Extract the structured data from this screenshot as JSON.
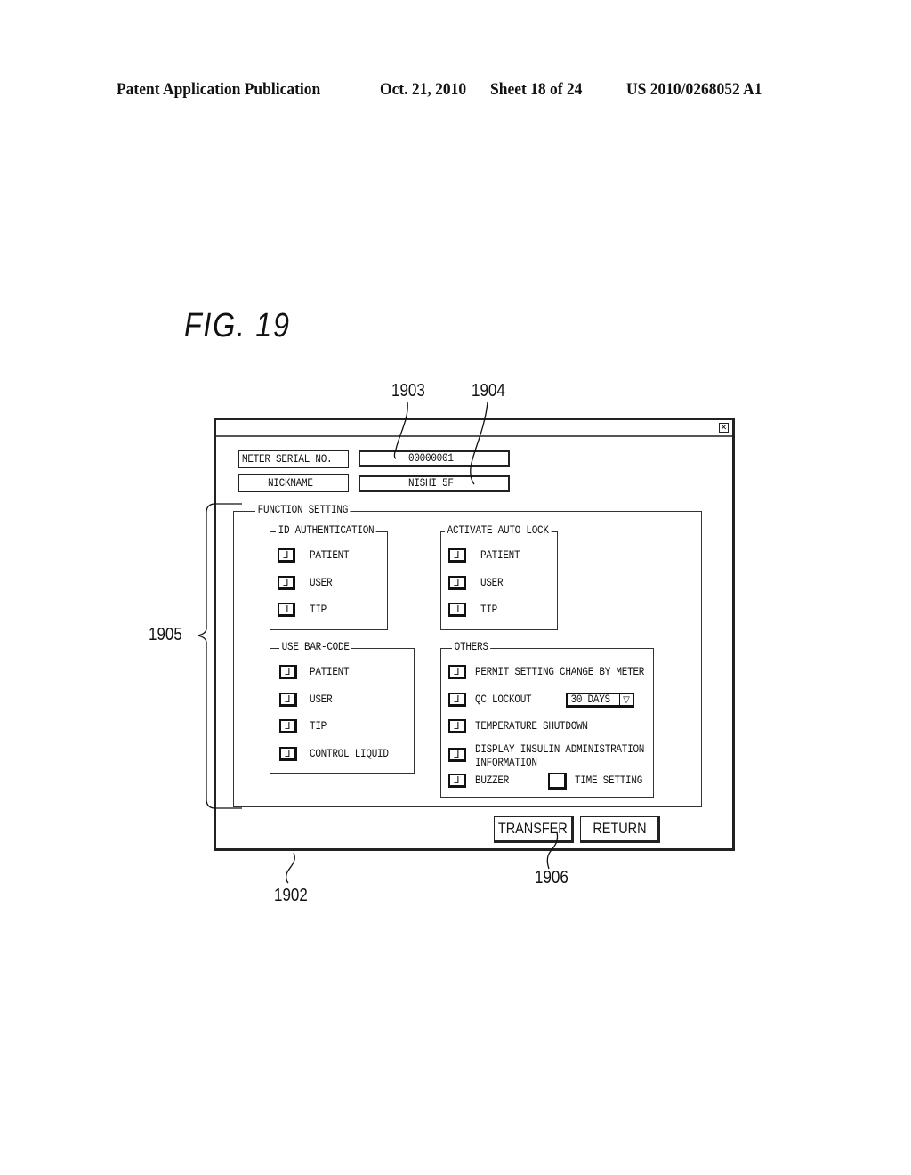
{
  "header": {
    "publication": "Patent Application Publication",
    "date": "Oct. 21, 2010",
    "sheet": "Sheet 18 of 24",
    "number": "US 2010/0268052 A1"
  },
  "figure": {
    "label": "FIG. 19"
  },
  "reference_numerals": {
    "window": "1902",
    "serial_field": "1903",
    "nickname_field": "1904",
    "function_setting": "1905",
    "transfer_button": "1906"
  },
  "dialog": {
    "close_icon": "close-icon",
    "meter_serial_label": "METER SERIAL NO.",
    "meter_serial_value": "00000001",
    "nickname_label": "NICKNAME",
    "nickname_value": "NISHI 5F",
    "function_setting": {
      "title": "FUNCTION SETTING",
      "id_authentication": {
        "title": "ID AUTHENTICATION",
        "items": [
          {
            "label": "PATIENT",
            "checked": true
          },
          {
            "label": "USER",
            "checked": true
          },
          {
            "label": "TIP",
            "checked": true
          }
        ]
      },
      "activate_auto_lock": {
        "title": "ACTIVATE AUTO LOCK",
        "items": [
          {
            "label": "PATIENT",
            "checked": true
          },
          {
            "label": "USER",
            "checked": true
          },
          {
            "label": "TIP",
            "checked": true
          }
        ]
      },
      "use_bar_code": {
        "title": "USE BAR-CODE",
        "items": [
          {
            "label": "PATIENT",
            "checked": true
          },
          {
            "label": "USER",
            "checked": true
          },
          {
            "label": "TIP",
            "checked": true
          },
          {
            "label": "CONTROL LIQUID",
            "checked": true
          }
        ]
      },
      "others": {
        "title": "OTHERS",
        "permit_setting_change": {
          "label": "PERMIT SETTING CHANGE BY METER",
          "checked": true
        },
        "qc_lockout": {
          "label": "QC LOCKOUT",
          "checked": true,
          "select_value": "30 DAYS"
        },
        "temperature_shutdown": {
          "label": "TEMPERATURE SHUTDOWN",
          "checked": true
        },
        "display_insulin": {
          "label_line1": "DISPLAY INSULIN ADMINISTRATION",
          "label_line2": "INFORMATION",
          "checked": true
        },
        "buzzer": {
          "label": "BUZZER",
          "checked": true
        },
        "time_setting": {
          "label": "TIME SETTING",
          "checked": false
        }
      }
    },
    "buttons": {
      "transfer": "TRANSFER",
      "return": "RETURN"
    },
    "check_glyph": "⅃"
  }
}
